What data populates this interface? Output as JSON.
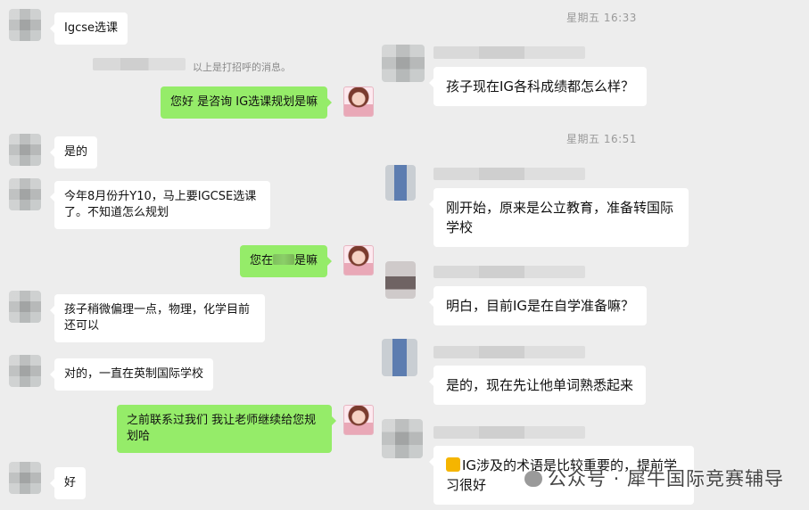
{
  "left_chat": {
    "messages": [
      {
        "text": "Igcse选课"
      },
      {
        "system_note": "以上是打招呼的消息。"
      },
      {
        "text": "您好 是咨询 IG选课规划是嘛"
      },
      {
        "text": "是的"
      },
      {
        "text": "今年8月份升Y10，马上要IGCSE选课了。不知道怎么规划"
      },
      {
        "text_before": "您在",
        "text_after": "是嘛"
      },
      {
        "text": "孩子稍微偏理一点，物理，化学目前还可以"
      },
      {
        "text": "对的，一直在英制国际学校"
      },
      {
        "text": "之前联系过我们 我让老师继续给您规划哈"
      },
      {
        "text": "好"
      }
    ]
  },
  "right_chat": {
    "time1": "星期五 16:33",
    "time2": "星期五 16:51",
    "messages": [
      {
        "text": "孩子现在IG各科成绩都怎么样？"
      },
      {
        "text": "刚开始，原来是公立教育，准备转国际学校"
      },
      {
        "text": "明白，目前IG是在自学准备嘛？"
      },
      {
        "text": "是的，现在先让他单词熟悉起来"
      },
      {
        "text": "IG涉及的术语是比较重要的，提前学习很好"
      }
    ]
  },
  "watermark": {
    "text": "公众号 · 犀牛国际竞赛辅导"
  },
  "colors": {
    "background": "#ededed",
    "bubble_white": "#ffffff",
    "bubble_green": "#95ec69"
  }
}
